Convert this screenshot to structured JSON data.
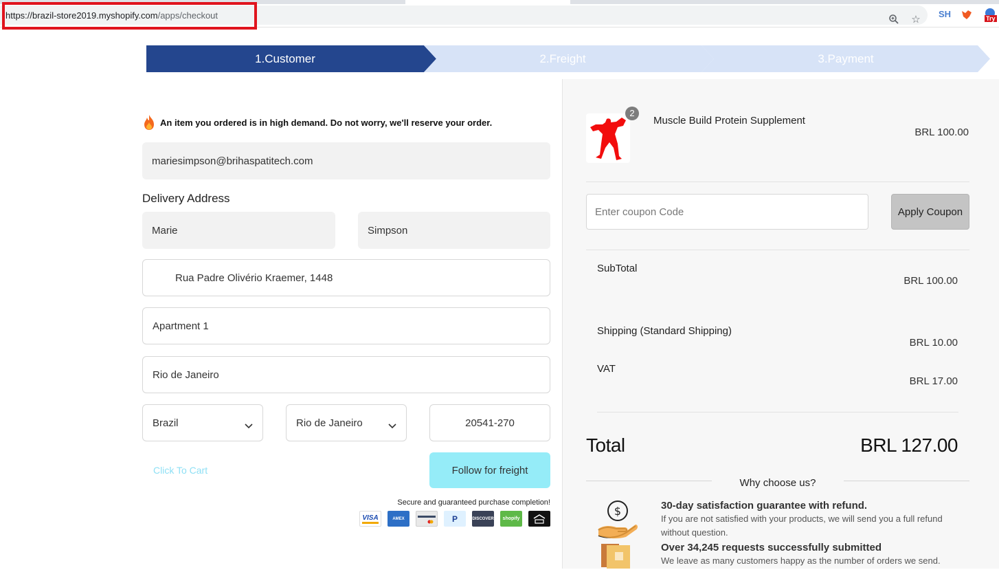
{
  "browser": {
    "url_host": "https://brazil-store2019.myshopify.com",
    "url_path": "/apps/checkout",
    "ext_sh": "SH",
    "ext_try": "Try"
  },
  "steps": [
    {
      "label": "1.Customer",
      "active": true
    },
    {
      "label": "2.Freight",
      "active": false
    },
    {
      "label": "3.Payment",
      "active": false
    }
  ],
  "customer": {
    "notice": "An item you ordered is in high demand. Do not worry, we'll reserve your order.",
    "email": "mariesimpson@brihaspatitech.com",
    "delivery_title": "Delivery Address",
    "first_name": "Marie",
    "last_name": "Simpson",
    "address": "Rua Padre Olivério Kraemer, 1448",
    "address2": "Apartment 1",
    "city": "Rio de Janeiro",
    "country": "Brazil",
    "state": "Rio de Janeiro",
    "zip": "20541-270",
    "cart_link": "Click To Cart",
    "freight_button": "Follow for freight",
    "secure_text": "Secure and guaranteed purchase completion!",
    "payment_icons": [
      "VISA",
      "AMEX",
      "CARD",
      "PayPal",
      "DISCOVER",
      "shopify",
      "BOLETO"
    ]
  },
  "summary": {
    "product_name": "Muscle Build Protein Supplement",
    "product_qty": "2",
    "product_price": "BRL 100.00",
    "coupon_placeholder": "Enter coupon Code",
    "coupon_button": "Apply Coupon",
    "subtotal_label": "SubTotal",
    "subtotal_value": "BRL 100.00",
    "shipping_label": "Shipping (Standard Shipping)",
    "shipping_value": "BRL 10.00",
    "vat_label": "VAT",
    "vat_value": "BRL 17.00",
    "total_label": "Total",
    "total_value": "BRL 127.00",
    "why_title": "Why choose us?",
    "reasons": [
      {
        "title": "30-day satisfaction guarantee with refund.",
        "text": "If you are not satisfied with your products, we will send you a full refund without question."
      },
      {
        "title": "Over 34,245 requests successfully submitted",
        "text": "We leave as many customers happy as the number of orders we send."
      }
    ]
  },
  "colors": {
    "step_active": "#24468e",
    "step_inactive": "#d7e3f7",
    "freight_button": "#95ecf8",
    "accent_link": "#8fe0f5"
  }
}
